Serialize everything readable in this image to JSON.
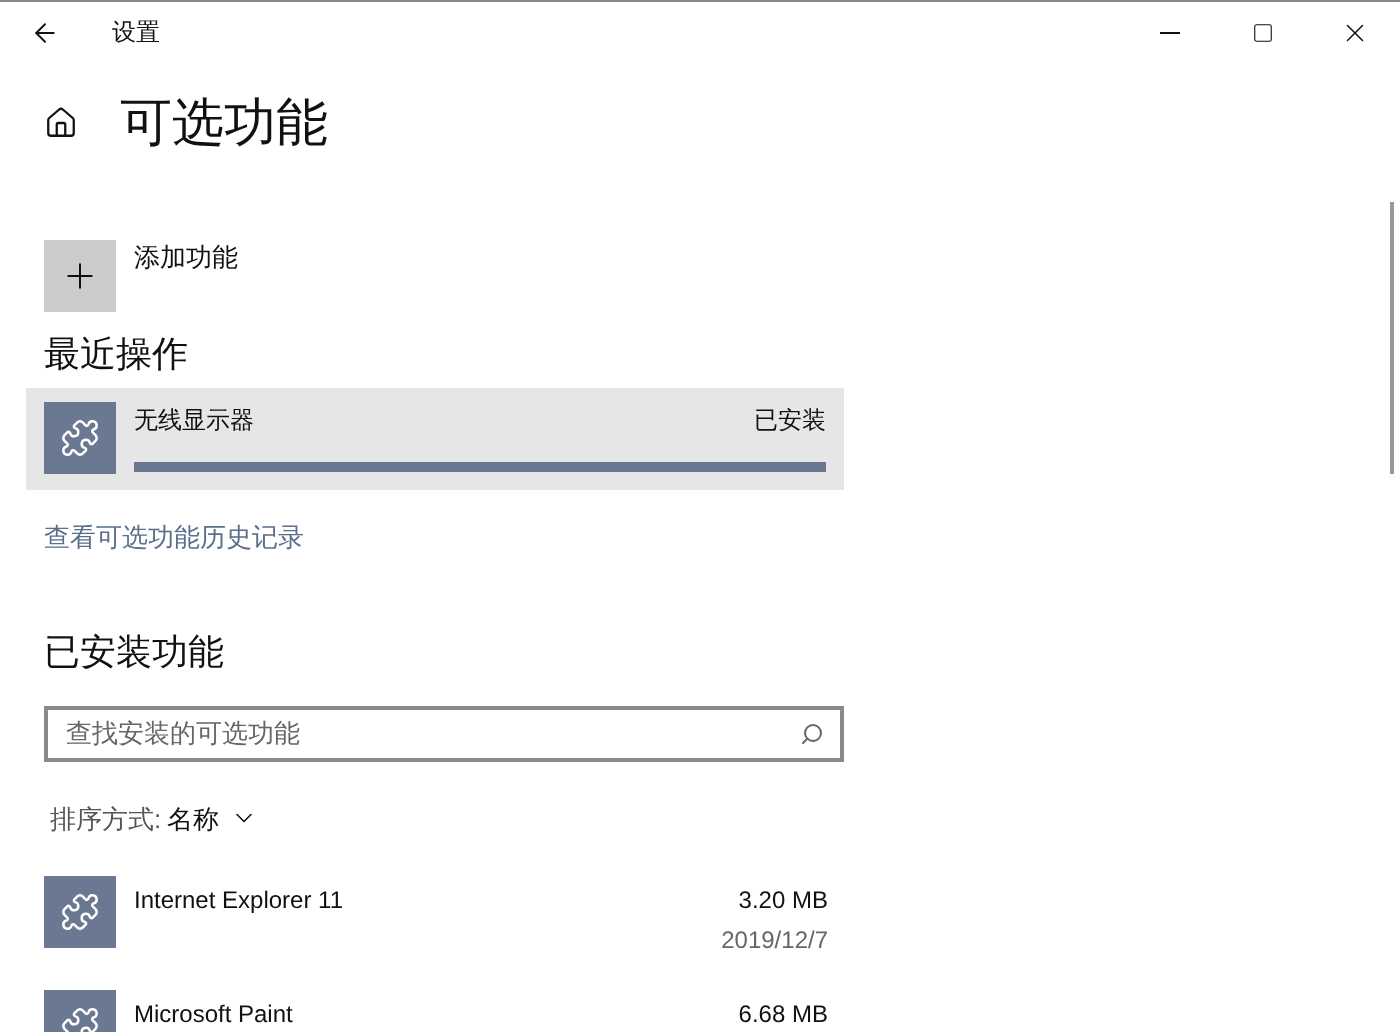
{
  "window": {
    "title": "设置"
  },
  "page": {
    "title": "可选功能"
  },
  "add_feature": {
    "label": "添加功能"
  },
  "recent": {
    "heading": "最近操作",
    "items": [
      {
        "name": "无线显示器",
        "status": "已安装",
        "level": 1
      }
    ]
  },
  "history_link": "查看可选功能历史记录",
  "installed": {
    "heading": "已安装功能",
    "search": {
      "placeholder": "查找安装的可选功能"
    },
    "sort": {
      "label": "排序方式:",
      "value": "名称"
    },
    "items": [
      {
        "name": "Internet Explorer 11",
        "size": "3.20 MB",
        "date": "2019/12/7"
      },
      {
        "name": "Microsoft Paint",
        "size": "6.68 MB"
      }
    ]
  }
}
